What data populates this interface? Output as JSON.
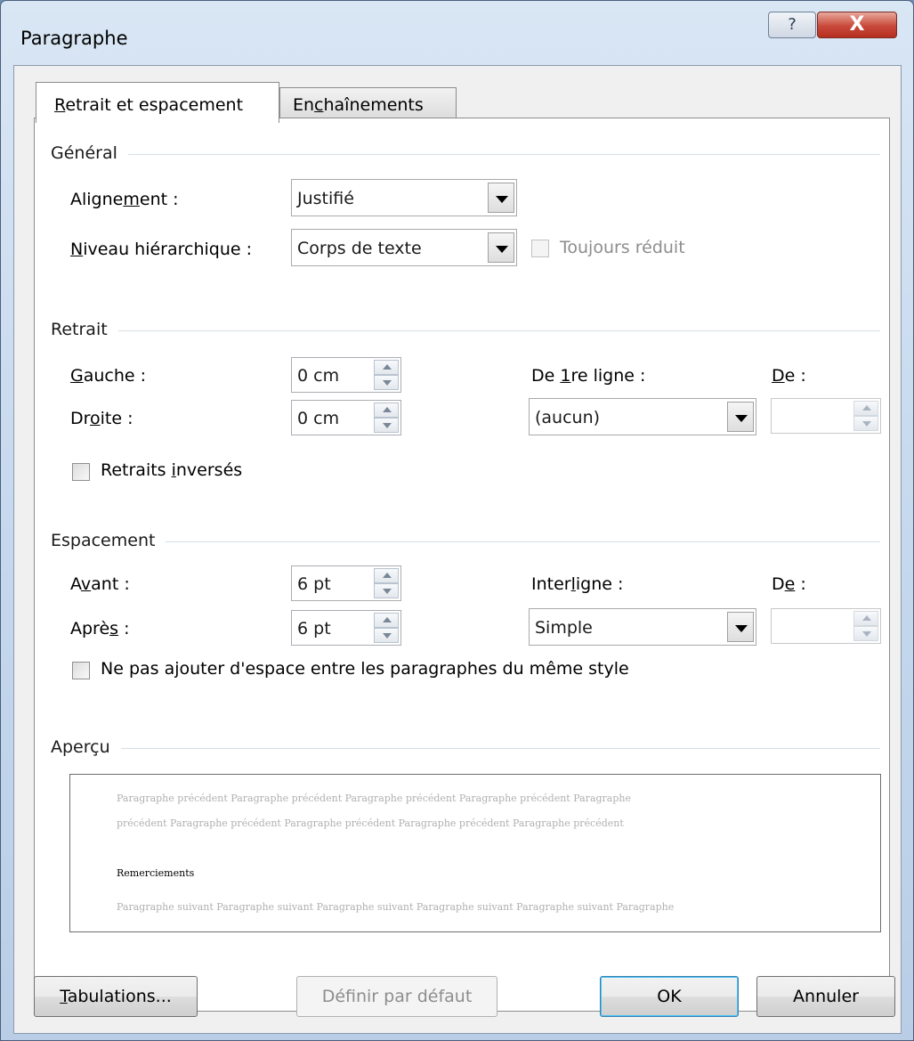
{
  "window": {
    "title": "Paragraphe",
    "help_glyph": "?",
    "close_glyph": "X"
  },
  "tabs": [
    {
      "label_prefix": "",
      "label_mnemonic": "R",
      "label_suffix": "etrait et espacement"
    },
    {
      "label_prefix": "En",
      "label_mnemonic": "c",
      "label_suffix": "haînements"
    }
  ],
  "general": {
    "heading": "Général",
    "alignment": {
      "label_prefix": "Aligne",
      "label_mnemonic": "m",
      "label_suffix": "ent :",
      "value": "Justifié"
    },
    "outline_level": {
      "label_prefix": "",
      "label_mnemonic": "N",
      "label_suffix": "iveau hiérarchique :",
      "value": "Corps de texte"
    },
    "collapsed": {
      "label": "Toujours réduit",
      "checked": false
    }
  },
  "indent": {
    "heading": "Retrait",
    "left": {
      "label_prefix": "",
      "label_mnemonic": "G",
      "label_suffix": "auche :",
      "value": "0 cm"
    },
    "right": {
      "label_prefix": "Dr",
      "label_mnemonic": "o",
      "label_suffix": "ite :",
      "value": "0 cm"
    },
    "special": {
      "label_prefix": "De ",
      "label_mnemonic": "1",
      "label_suffix": "re ligne :",
      "value": "(aucun)"
    },
    "by": {
      "label_prefix": "",
      "label_mnemonic": "D",
      "label_suffix": "e :",
      "value": ""
    },
    "mirror": {
      "label_prefix": "Retraits ",
      "label_mnemonic": "i",
      "label_suffix": "nversés",
      "checked": false
    }
  },
  "spacing": {
    "heading": "Espacement",
    "before": {
      "label_prefix": "A",
      "label_mnemonic": "v",
      "label_suffix": "ant :",
      "value": "6 pt"
    },
    "after": {
      "label_prefix": "Aprè",
      "label_mnemonic": "s",
      "label_suffix": " :",
      "value": "6 pt"
    },
    "line": {
      "label_prefix": "Inter",
      "label_mnemonic": "l",
      "label_suffix": "igne :",
      "value": "Simple"
    },
    "at": {
      "label_prefix": "D",
      "label_mnemonic": "e",
      "label_suffix": " :",
      "value": ""
    },
    "no_space": {
      "label_prefix": "Ne pas a",
      "label_mnemonic": "j",
      "label_suffix": "outer d'espace entre les paragraphes du même style",
      "checked": false
    }
  },
  "preview": {
    "heading": "Aperçu",
    "prev_line1": "Paragraphe précédent Paragraphe précédent Paragraphe précédent Paragraphe précédent Paragraphe",
    "prev_line2": "précédent Paragraphe précédent Paragraphe précédent Paragraphe précédent Paragraphe précédent",
    "current": "Remerciements",
    "next_line": "Paragraphe suivant Paragraphe suivant Paragraphe suivant Paragraphe suivant Paragraphe suivant Paragraphe"
  },
  "buttons": {
    "tabs": {
      "label_prefix": "",
      "label_mnemonic": "T",
      "label_suffix": "abulations..."
    },
    "set_default": "Définir par défaut",
    "ok": "OK",
    "cancel": "Annuler"
  }
}
